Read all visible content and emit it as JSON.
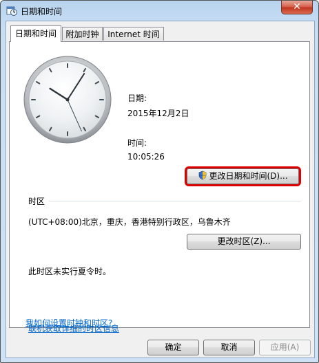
{
  "window": {
    "title": "日期和时间",
    "close_icon": "close-icon"
  },
  "tabs": [
    {
      "label": "日期和时间",
      "active": true
    },
    {
      "label": "附加时钟",
      "active": false
    },
    {
      "label": "Internet 时间",
      "active": false
    }
  ],
  "datetime": {
    "date_label": "日期:",
    "date_value": "2015年12月2日",
    "time_label": "时间:",
    "time_value": "10:05:26",
    "change_button": "更改日期和时间(D)..."
  },
  "timezone": {
    "section_label": "时区",
    "value": "(UTC+08:00)北京，重庆，香港特别行政区，乌鲁木齐",
    "change_button": "更改时区(Z)...",
    "dst_note": "此时区未实行夏令时。"
  },
  "links": {
    "online_info": "联机获取详细的时区信息",
    "how_to": "我如何设置时钟和时区?"
  },
  "footer": {
    "ok": "确定",
    "cancel": "取消",
    "apply": "应用(A)"
  },
  "clock": {
    "hour": 10,
    "minute": 5,
    "second": 26
  },
  "colors": {
    "highlight_border": "#dd0000",
    "link": "#0066cc"
  }
}
